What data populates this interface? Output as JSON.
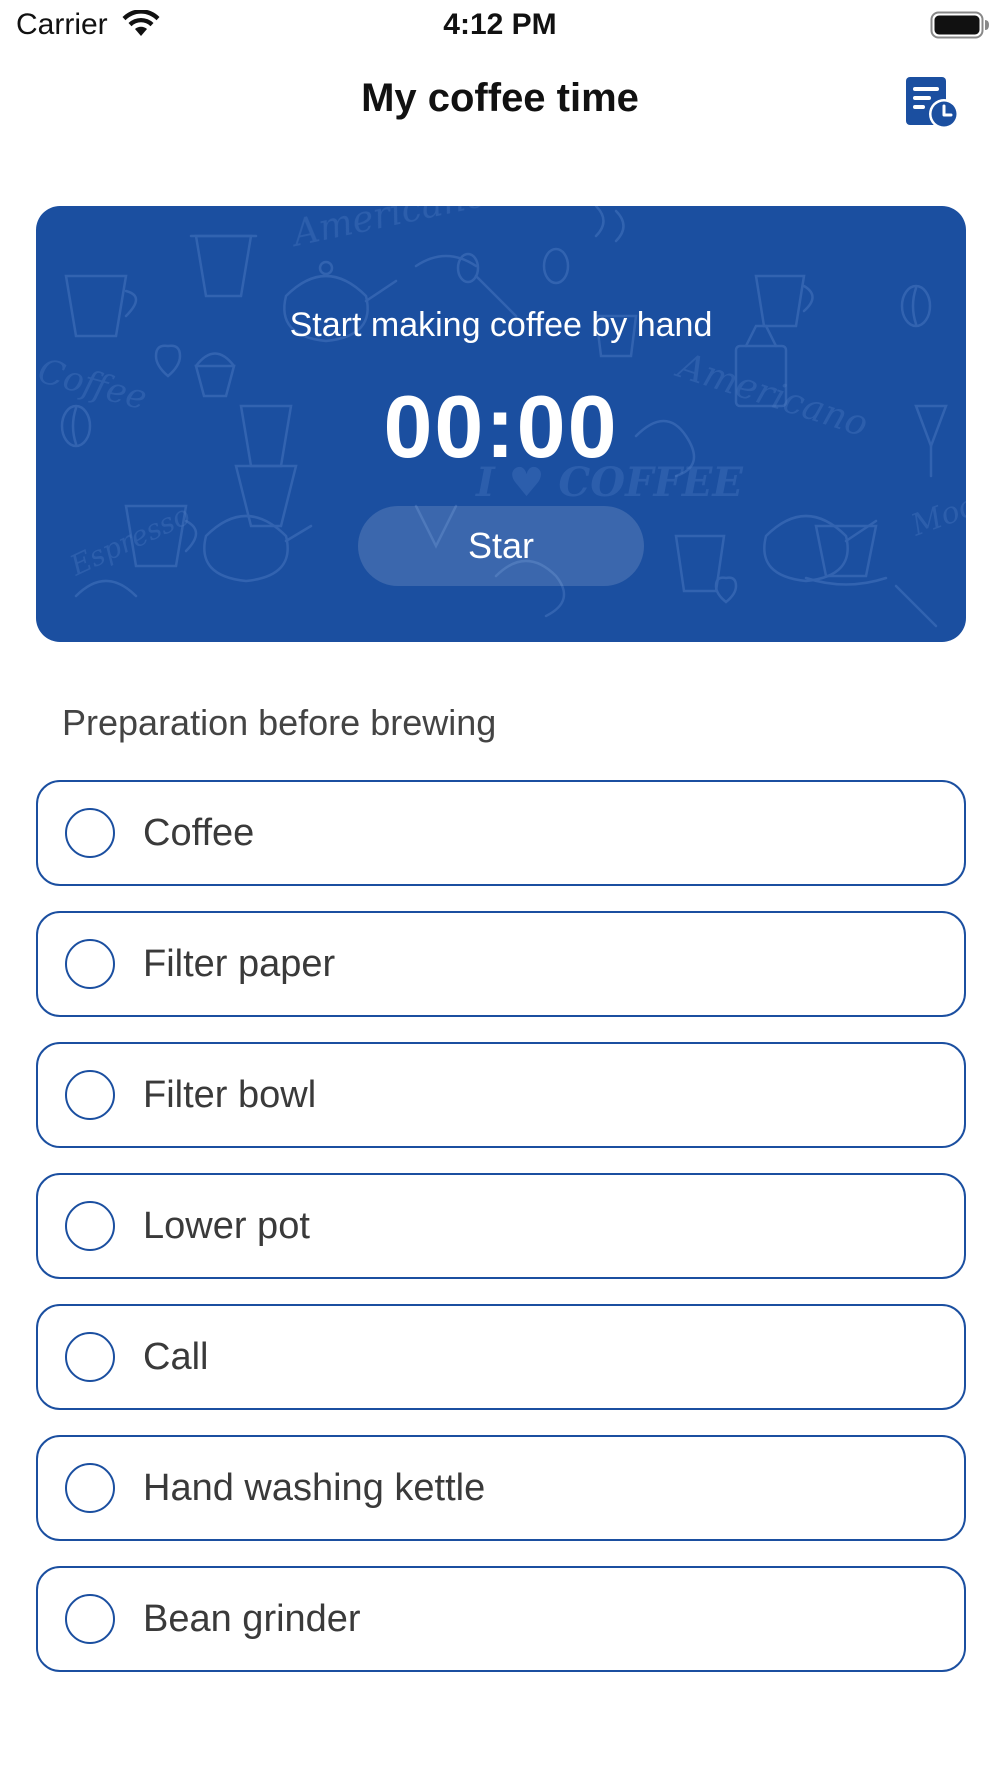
{
  "status_bar": {
    "carrier": "Carrier",
    "time": "4:12 PM"
  },
  "nav": {
    "title": "My coffee time",
    "history_icon": "history-list-icon"
  },
  "timer_card": {
    "subtitle": "Start making coffee by hand",
    "timer": "00:00",
    "button_label": "Star",
    "background_color": "#1b4fa0"
  },
  "checklist": {
    "title": "Preparation before brewing",
    "items": [
      {
        "label": "Coffee",
        "checked": false
      },
      {
        "label": "Filter paper",
        "checked": false
      },
      {
        "label": "Filter bowl",
        "checked": false
      },
      {
        "label": "Lower pot",
        "checked": false
      },
      {
        "label": "Call",
        "checked": false
      },
      {
        "label": "Hand washing kettle",
        "checked": false
      },
      {
        "label": "Bean grinder",
        "checked": false
      }
    ]
  },
  "colors": {
    "accent": "#1b4fa0",
    "text": "#3a3a3a"
  }
}
